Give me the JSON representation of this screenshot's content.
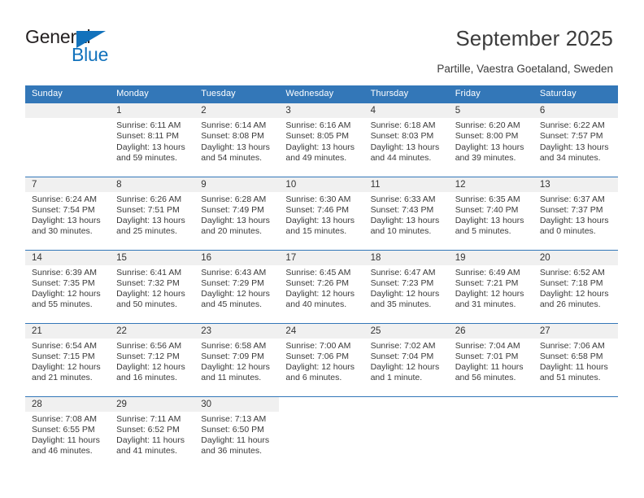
{
  "brand": {
    "name_part1": "General",
    "name_part2": "Blue",
    "triangle_color": "#1272bc",
    "text_color": "#231f20"
  },
  "header": {
    "title": "September 2025",
    "subtitle": "Partille, Vaestra Goetaland, Sweden",
    "accent_color": "#3377b8",
    "daynum_bg": "#f0f0f0"
  },
  "calendar": {
    "weekday_headers": [
      "Sunday",
      "Monday",
      "Tuesday",
      "Wednesday",
      "Thursday",
      "Friday",
      "Saturday"
    ],
    "weeks": [
      [
        {
          "day": "",
          "sunrise": "",
          "sunset": "",
          "daylight_line1": "",
          "daylight_line2": ""
        },
        {
          "day": "1",
          "sunrise": "Sunrise: 6:11 AM",
          "sunset": "Sunset: 8:11 PM",
          "daylight_line1": "Daylight: 13 hours",
          "daylight_line2": "and 59 minutes."
        },
        {
          "day": "2",
          "sunrise": "Sunrise: 6:14 AM",
          "sunset": "Sunset: 8:08 PM",
          "daylight_line1": "Daylight: 13 hours",
          "daylight_line2": "and 54 minutes."
        },
        {
          "day": "3",
          "sunrise": "Sunrise: 6:16 AM",
          "sunset": "Sunset: 8:05 PM",
          "daylight_line1": "Daylight: 13 hours",
          "daylight_line2": "and 49 minutes."
        },
        {
          "day": "4",
          "sunrise": "Sunrise: 6:18 AM",
          "sunset": "Sunset: 8:03 PM",
          "daylight_line1": "Daylight: 13 hours",
          "daylight_line2": "and 44 minutes."
        },
        {
          "day": "5",
          "sunrise": "Sunrise: 6:20 AM",
          "sunset": "Sunset: 8:00 PM",
          "daylight_line1": "Daylight: 13 hours",
          "daylight_line2": "and 39 minutes."
        },
        {
          "day": "6",
          "sunrise": "Sunrise: 6:22 AM",
          "sunset": "Sunset: 7:57 PM",
          "daylight_line1": "Daylight: 13 hours",
          "daylight_line2": "and 34 minutes."
        }
      ],
      [
        {
          "day": "7",
          "sunrise": "Sunrise: 6:24 AM",
          "sunset": "Sunset: 7:54 PM",
          "daylight_line1": "Daylight: 13 hours",
          "daylight_line2": "and 30 minutes."
        },
        {
          "day": "8",
          "sunrise": "Sunrise: 6:26 AM",
          "sunset": "Sunset: 7:51 PM",
          "daylight_line1": "Daylight: 13 hours",
          "daylight_line2": "and 25 minutes."
        },
        {
          "day": "9",
          "sunrise": "Sunrise: 6:28 AM",
          "sunset": "Sunset: 7:49 PM",
          "daylight_line1": "Daylight: 13 hours",
          "daylight_line2": "and 20 minutes."
        },
        {
          "day": "10",
          "sunrise": "Sunrise: 6:30 AM",
          "sunset": "Sunset: 7:46 PM",
          "daylight_line1": "Daylight: 13 hours",
          "daylight_line2": "and 15 minutes."
        },
        {
          "day": "11",
          "sunrise": "Sunrise: 6:33 AM",
          "sunset": "Sunset: 7:43 PM",
          "daylight_line1": "Daylight: 13 hours",
          "daylight_line2": "and 10 minutes."
        },
        {
          "day": "12",
          "sunrise": "Sunrise: 6:35 AM",
          "sunset": "Sunset: 7:40 PM",
          "daylight_line1": "Daylight: 13 hours",
          "daylight_line2": "and 5 minutes."
        },
        {
          "day": "13",
          "sunrise": "Sunrise: 6:37 AM",
          "sunset": "Sunset: 7:37 PM",
          "daylight_line1": "Daylight: 13 hours",
          "daylight_line2": "and 0 minutes."
        }
      ],
      [
        {
          "day": "14",
          "sunrise": "Sunrise: 6:39 AM",
          "sunset": "Sunset: 7:35 PM",
          "daylight_line1": "Daylight: 12 hours",
          "daylight_line2": "and 55 minutes."
        },
        {
          "day": "15",
          "sunrise": "Sunrise: 6:41 AM",
          "sunset": "Sunset: 7:32 PM",
          "daylight_line1": "Daylight: 12 hours",
          "daylight_line2": "and 50 minutes."
        },
        {
          "day": "16",
          "sunrise": "Sunrise: 6:43 AM",
          "sunset": "Sunset: 7:29 PM",
          "daylight_line1": "Daylight: 12 hours",
          "daylight_line2": "and 45 minutes."
        },
        {
          "day": "17",
          "sunrise": "Sunrise: 6:45 AM",
          "sunset": "Sunset: 7:26 PM",
          "daylight_line1": "Daylight: 12 hours",
          "daylight_line2": "and 40 minutes."
        },
        {
          "day": "18",
          "sunrise": "Sunrise: 6:47 AM",
          "sunset": "Sunset: 7:23 PM",
          "daylight_line1": "Daylight: 12 hours",
          "daylight_line2": "and 35 minutes."
        },
        {
          "day": "19",
          "sunrise": "Sunrise: 6:49 AM",
          "sunset": "Sunset: 7:21 PM",
          "daylight_line1": "Daylight: 12 hours",
          "daylight_line2": "and 31 minutes."
        },
        {
          "day": "20",
          "sunrise": "Sunrise: 6:52 AM",
          "sunset": "Sunset: 7:18 PM",
          "daylight_line1": "Daylight: 12 hours",
          "daylight_line2": "and 26 minutes."
        }
      ],
      [
        {
          "day": "21",
          "sunrise": "Sunrise: 6:54 AM",
          "sunset": "Sunset: 7:15 PM",
          "daylight_line1": "Daylight: 12 hours",
          "daylight_line2": "and 21 minutes."
        },
        {
          "day": "22",
          "sunrise": "Sunrise: 6:56 AM",
          "sunset": "Sunset: 7:12 PM",
          "daylight_line1": "Daylight: 12 hours",
          "daylight_line2": "and 16 minutes."
        },
        {
          "day": "23",
          "sunrise": "Sunrise: 6:58 AM",
          "sunset": "Sunset: 7:09 PM",
          "daylight_line1": "Daylight: 12 hours",
          "daylight_line2": "and 11 minutes."
        },
        {
          "day": "24",
          "sunrise": "Sunrise: 7:00 AM",
          "sunset": "Sunset: 7:06 PM",
          "daylight_line1": "Daylight: 12 hours",
          "daylight_line2": "and 6 minutes."
        },
        {
          "day": "25",
          "sunrise": "Sunrise: 7:02 AM",
          "sunset": "Sunset: 7:04 PM",
          "daylight_line1": "Daylight: 12 hours",
          "daylight_line2": "and 1 minute."
        },
        {
          "day": "26",
          "sunrise": "Sunrise: 7:04 AM",
          "sunset": "Sunset: 7:01 PM",
          "daylight_line1": "Daylight: 11 hours",
          "daylight_line2": "and 56 minutes."
        },
        {
          "day": "27",
          "sunrise": "Sunrise: 7:06 AM",
          "sunset": "Sunset: 6:58 PM",
          "daylight_line1": "Daylight: 11 hours",
          "daylight_line2": "and 51 minutes."
        }
      ],
      [
        {
          "day": "28",
          "sunrise": "Sunrise: 7:08 AM",
          "sunset": "Sunset: 6:55 PM",
          "daylight_line1": "Daylight: 11 hours",
          "daylight_line2": "and 46 minutes."
        },
        {
          "day": "29",
          "sunrise": "Sunrise: 7:11 AM",
          "sunset": "Sunset: 6:52 PM",
          "daylight_line1": "Daylight: 11 hours",
          "daylight_line2": "and 41 minutes."
        },
        {
          "day": "30",
          "sunrise": "Sunrise: 7:13 AM",
          "sunset": "Sunset: 6:50 PM",
          "daylight_line1": "Daylight: 11 hours",
          "daylight_line2": "and 36 minutes."
        },
        {
          "day": "",
          "sunrise": "",
          "sunset": "",
          "daylight_line1": "",
          "daylight_line2": ""
        },
        {
          "day": "",
          "sunrise": "",
          "sunset": "",
          "daylight_line1": "",
          "daylight_line2": ""
        },
        {
          "day": "",
          "sunrise": "",
          "sunset": "",
          "daylight_line1": "",
          "daylight_line2": ""
        },
        {
          "day": "",
          "sunrise": "",
          "sunset": "",
          "daylight_line1": "",
          "daylight_line2": ""
        }
      ]
    ]
  }
}
